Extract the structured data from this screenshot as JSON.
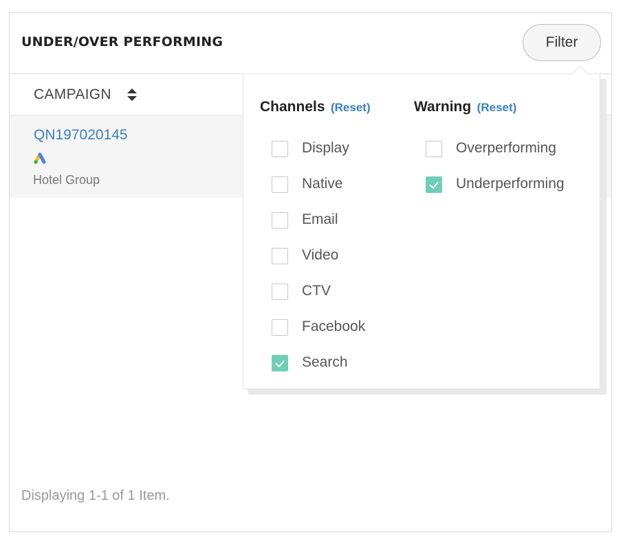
{
  "panel": {
    "title": "UNDER/OVER PERFORMING",
    "filter_label": "Filter"
  },
  "table": {
    "columns": [
      {
        "label": "CAMPAIGN",
        "sort_icon": "sort-icon"
      }
    ],
    "rows": [
      {
        "campaign_id": "QN197020145",
        "channel_icon": "google-ads-icon",
        "client": "Hotel Group"
      }
    ],
    "footer": "Displaying 1-1 of 1 Item."
  },
  "filter_dropdown": {
    "channels": {
      "heading": "Channels",
      "reset_label": "(Reset)",
      "options": [
        {
          "label": "Display",
          "checked": false
        },
        {
          "label": "Native",
          "checked": false
        },
        {
          "label": "Email",
          "checked": false
        },
        {
          "label": "Video",
          "checked": false
        },
        {
          "label": "CTV",
          "checked": false
        },
        {
          "label": "Facebook",
          "checked": false
        },
        {
          "label": "Search",
          "checked": true
        }
      ]
    },
    "warning": {
      "heading": "Warning",
      "reset_label": "(Reset)",
      "options": [
        {
          "label": "Overperforming",
          "checked": false
        },
        {
          "label": "Underperforming",
          "checked": true
        }
      ]
    }
  },
  "colors": {
    "link": "#3b7fc4",
    "checkbox_checked": "#6fcfb6",
    "row_background": "#f5f5f5"
  }
}
